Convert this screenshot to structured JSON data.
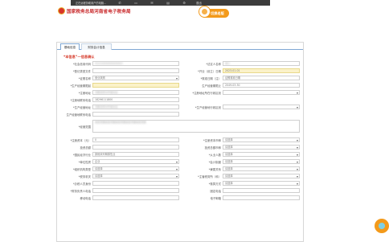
{
  "toolbar": {
    "status_text": "正在远程协助用户的电脑...",
    "exit_label": "退出"
  },
  "header": {
    "title": "国家税务总局河南省电子税务局",
    "switch_label": "切换老版"
  },
  "tabs": [
    {
      "label": "基础信息",
      "active": true
    },
    {
      "label": "财务会计信息",
      "active": false
    }
  ],
  "section": {
    "title": "*本信息“一信息确认"
  },
  "form": {
    "taxpayer_id_label": "*社会信用代码",
    "taxpayer_id_value": "",
    "legal_rep_label": "*法定人名称",
    "legal_rep_value": "",
    "reg_doc_label": "*登记类型文件",
    "reg_doc_value": "",
    "open_date_label": "*开业（设立）日期",
    "open_date_value": "2023-01-01",
    "reg_type_label": "*证照名称",
    "reg_type_value": "营业执照",
    "approval_date_label": "*核准日期（注）",
    "approval_date_value": "证照核准日期",
    "prod_addr_label": "*生产经营期限起",
    "prod_addr_value": "",
    "prod_end_label": "生产经营期限止",
    "prod_end_value": "2049-03-30",
    "reg_addr_label": "*注册地址",
    "reg_addr_value": "",
    "reg_district_label": "*注册地址所在行政区划",
    "reg_district_value": "",
    "reg_phone_label": "*注册地联系电话",
    "reg_phone_value": "18296111800",
    "biz_addr_label": "*生产经营地址",
    "biz_addr_value": "",
    "biz_district_label": "*生产经营地行政区划",
    "biz_district_value": "",
    "biz_phone_label": "生产经营地联系电话",
    "biz_phone_value": "",
    "biz_scope_label": "*经营范围",
    "biz_scope_value": "",
    "capital_label": "*注册资本（元）",
    "capital_value": "0",
    "currency_label": "*注册资本币种",
    "currency_value": "请选择",
    "invest_label": "投资总额",
    "invest_value": "",
    "invest_currency_label": "投资总额币种",
    "invest_currency_value": "请选择",
    "industry_label": "*国民经济行业",
    "industry_value": "其他未列明零售业",
    "accounting_label": "*从业人数",
    "accounting_value": "请选择",
    "unit_nature_label": "*单位性质",
    "unit_nature_value": "企业",
    "accounting_system_label": "*会计制度",
    "accounting_system_value": "请选择",
    "org_type_label": "*组织机构类型",
    "org_type_value": "请选择",
    "affiliation_label": "*隶属关系",
    "affiliation_value": "请选择",
    "tax_org_label": "*税务机关",
    "tax_org_value": "请选择",
    "main_tax_label": "*主管税务所（科）",
    "main_tax_value": "请选择",
    "deputy_label": "*办税人员身份",
    "deputy_value": "",
    "nature_label": "*核算方式",
    "nature_value": "请选择",
    "fixed_phone_label": "*财务负责人电话",
    "fixed_phone_value": "",
    "fixed_tel_label": "固定电话",
    "fixed_tel_value": "",
    "mobile_label": "移动电话",
    "mobile_value": "",
    "email_label": "电子邮箱",
    "email_value": ""
  }
}
